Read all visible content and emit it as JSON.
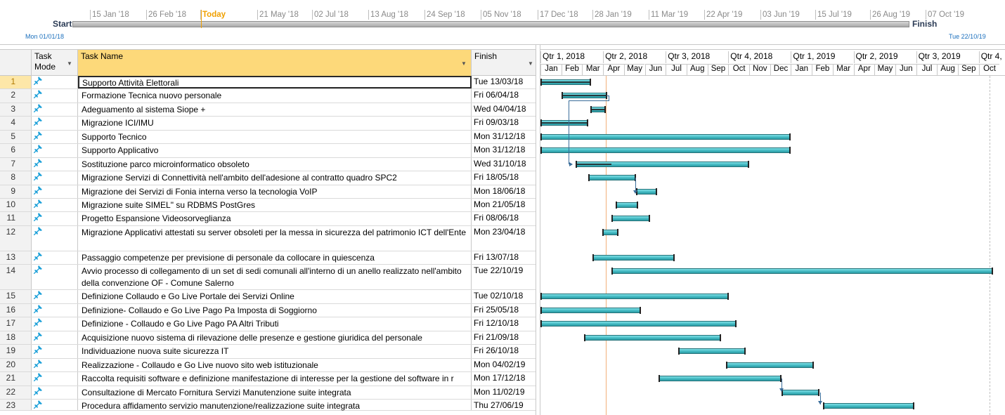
{
  "timeline": {
    "dates": [
      "15 Jan '18",
      "26 Feb '18",
      "Today",
      "21 May '18",
      "02 Jul '18",
      "13 Aug '18",
      "24 Sep '18",
      "05 Nov '18",
      "17 Dec '18",
      "28 Jan '19",
      "11 Mar '19",
      "22 Apr '19",
      "03 Jun '19",
      "15 Jul '19",
      "26 Aug '19",
      "07 Oct '19"
    ],
    "start_label": "Start",
    "start_date": "Mon 01/01/18",
    "finish_label": "Finish",
    "finish_date": "Tue 22/10/19"
  },
  "columns": {
    "id": "",
    "task_mode": "Task Mode",
    "task_name": "Task Name",
    "finish": "Finish"
  },
  "gantt_header": {
    "quarters": [
      "Qtr 1, 2018",
      "Qtr 2, 2018",
      "Qtr 3, 2018",
      "Qtr 4, 2018",
      "Qtr 1, 2019",
      "Qtr 2, 2019",
      "Qtr 3, 2019",
      "Qtr 4,"
    ],
    "months": [
      "Jan",
      "Feb",
      "Mar",
      "Apr",
      "May",
      "Jun",
      "Jul",
      "Aug",
      "Sep",
      "Oct",
      "Nov",
      "Dec",
      "Jan",
      "Feb",
      "Mar",
      "Apr",
      "May",
      "Jun",
      "Jul",
      "Aug",
      "Sep",
      "Oct"
    ]
  },
  "colors": {
    "bar": "#3fb6bf",
    "today": "#f0a000",
    "selected_header": "#fdd97a",
    "pin_icon": "#1a9fd8"
  },
  "tasks": [
    {
      "id": "1",
      "name": "Supporto Attività Elettorali",
      "finish": "Tue 13/03/18",
      "start_month": 0.0,
      "end_month": 2.42,
      "progress": 1.0
    },
    {
      "id": "2",
      "name": "Formazione Tecnica nuovo personale",
      "finish": "Fri 06/04/18",
      "start_month": 1.0,
      "end_month": 3.2,
      "progress": 1.0
    },
    {
      "id": "3",
      "name": "Adeguamento al sistema Siope +",
      "finish": "Wed 04/04/18",
      "start_month": 2.4,
      "end_month": 3.13,
      "progress": 1.0
    },
    {
      "id": "4",
      "name": "Migrazione ICI/IMU",
      "finish": "Fri 09/03/18",
      "start_month": 0.0,
      "end_month": 2.29,
      "progress": 1.0
    },
    {
      "id": "5",
      "name": "Supporto Tecnico",
      "finish": "Mon 31/12/18",
      "start_month": 0.0,
      "end_month": 12.0,
      "progress": 0.0
    },
    {
      "id": "6",
      "name": "Supporto Applicativo",
      "finish": "Mon 31/12/18",
      "start_month": 0.0,
      "end_month": 12.0,
      "progress": 0.0
    },
    {
      "id": "7",
      "name": "Sostituzione parco microinformatico obsoleto",
      "finish": "Wed 31/10/18",
      "start_month": 1.7,
      "end_month": 10.0,
      "progress": 0.2
    },
    {
      "id": "8",
      "name": "Migrazione Servizi di Connettività nell'ambito dell'adesione al contratto quadro SPC2",
      "finish": "Fri 18/05/18",
      "start_month": 2.3,
      "end_month": 4.58,
      "progress": 0.0
    },
    {
      "id": "9",
      "name": "Migrazione dei Servizi di Fonia interna verso la tecnologia VoIP",
      "finish": "Mon 18/06/18",
      "start_month": 4.58,
      "end_month": 5.58,
      "progress": 0.0
    },
    {
      "id": "10",
      "name": "Migrazione suite SIMEL\" su RDBMS PostGres",
      "finish": "Mon 21/05/18",
      "start_month": 3.6,
      "end_month": 4.68,
      "progress": 0.0
    },
    {
      "id": "11",
      "name": "Progetto Espansione Videosorveglianza",
      "finish": "Fri 08/06/18",
      "start_month": 3.4,
      "end_month": 5.26,
      "progress": 0.0
    },
    {
      "id": "12",
      "name": "Migrazione Applicativi attestati su server obsoleti per la messa in sicurezza del patrimonio ICT dell'Ente",
      "finish": "Mon 23/04/18",
      "start_month": 2.95,
      "end_month": 3.75,
      "progress": 0.0
    },
    {
      "id": "13",
      "name": "Passaggio competenze per previsione di personale da collocare in quiescenza",
      "finish": "Fri 13/07/18",
      "start_month": 2.5,
      "end_month": 6.42,
      "progress": 0.0
    },
    {
      "id": "14",
      "name": "Avvio processo di collegamento di un set di sedi comunali all'interno di un anello realizzato nell'ambito della convenzione OF - Comune Salerno",
      "finish": "Tue 22/10/19",
      "start_month": 3.4,
      "end_month": 21.7,
      "progress": 0.0
    },
    {
      "id": "15",
      "name": "Definizione Collaudo e Go Live Portale dei Servizi Online",
      "finish": "Tue 02/10/18",
      "start_month": 0.0,
      "end_month": 9.03,
      "progress": 0.0
    },
    {
      "id": "16",
      "name": "Definizione- Collaudo e Go Live Pago Pa Imposta di Soggiorno",
      "finish": "Fri 25/05/18",
      "start_month": 0.0,
      "end_month": 4.8,
      "progress": 0.0
    },
    {
      "id": "17",
      "name": "Definizione - Collaudo e Go Live Pago PA Altri Tributi",
      "finish": "Fri 12/10/18",
      "start_month": 0.0,
      "end_month": 9.38,
      "progress": 0.0
    },
    {
      "id": "18",
      "name": "Acquisizione nuovo sistema di rilevazione delle presenze e gestione giuridica del personale",
      "finish": "Fri 21/09/18",
      "start_month": 2.1,
      "end_month": 8.67,
      "progress": 0.0
    },
    {
      "id": "19",
      "name": "Individuazione nuova suite sicurezza IT",
      "finish": "Fri 26/10/18",
      "start_month": 6.6,
      "end_month": 9.84,
      "progress": 0.0
    },
    {
      "id": "20",
      "name": "Realizzazione - Collaudo e Go Live nuovo sito web istituzionale",
      "finish": "Mon 04/02/19",
      "start_month": 8.9,
      "end_month": 13.1,
      "progress": 0.0
    },
    {
      "id": "21",
      "name": "Raccolta requisiti software e definizione manifestazione di interesse per la gestione del software in r",
      "finish": "Mon 17/12/18",
      "start_month": 5.65,
      "end_month": 11.55,
      "progress": 0.0
    },
    {
      "id": "22",
      "name": "Consultazione di Mercato Fornitura Servizi Manutenzione suite integrata",
      "finish": "Mon 11/02/19",
      "start_month": 11.55,
      "end_month": 13.36,
      "progress": 0.0
    },
    {
      "id": "23",
      "name": "Procedura affidamento servizio manutenzione/realizzazione suite integrata",
      "finish": "Thu 27/06/19",
      "start_month": 13.55,
      "end_month": 17.9,
      "progress": 0.0
    }
  ]
}
